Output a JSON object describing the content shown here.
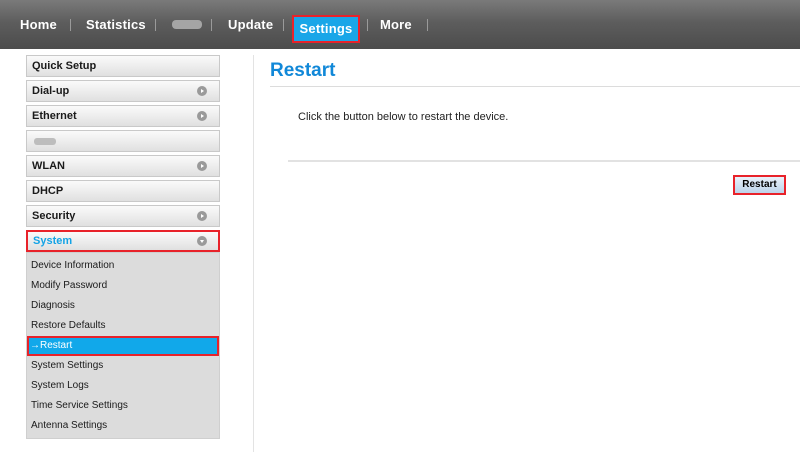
{
  "nav": {
    "home": "Home",
    "statistics": "Statistics",
    "update": "Update",
    "settings": "Settings",
    "more": "More"
  },
  "sidebar": {
    "items": [
      {
        "label": "Quick Setup",
        "expandable": false
      },
      {
        "label": "Dial-up",
        "expandable": true
      },
      {
        "label": "Ethernet",
        "expandable": true
      },
      {
        "label": "",
        "expandable": false,
        "blurred": true
      },
      {
        "label": "WLAN",
        "expandable": true
      },
      {
        "label": "DHCP",
        "expandable": false
      },
      {
        "label": "Security",
        "expandable": true
      },
      {
        "label": "System",
        "expandable": true,
        "expanded": true
      }
    ],
    "system_submenu": [
      "Device Information",
      "Modify Password",
      "Diagnosis",
      "Restore Defaults",
      "→Restart",
      "System Settings",
      "System Logs",
      "Time Service Settings",
      "Antenna Settings"
    ]
  },
  "main": {
    "title": "Restart",
    "description": "Click the button below to restart the device.",
    "restart_button": "Restart"
  },
  "colors": {
    "accent": "#1188d8",
    "highlight_border": "#e8222a",
    "selected_bg": "#11a8ea"
  }
}
